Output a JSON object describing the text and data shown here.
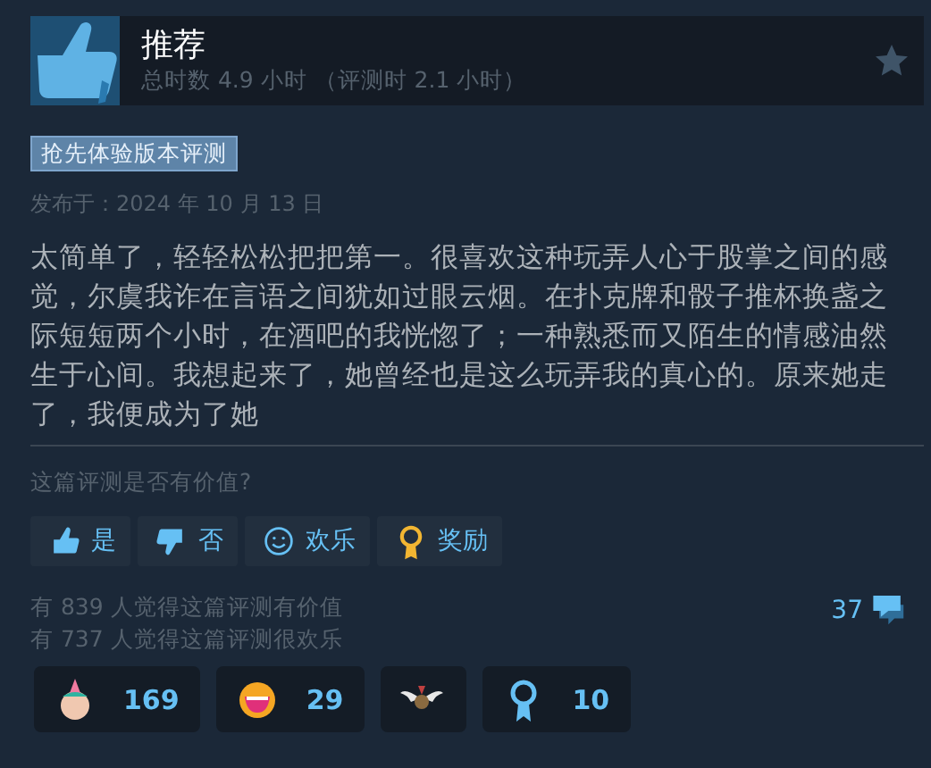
{
  "header": {
    "verdict": "推荐",
    "hours": "总时数 4.9 小时 （评测时 2.1 小时）",
    "recommended": true
  },
  "tag": "抢先体验版本评测",
  "posted": "发布于：2024 年 10 月 13 日",
  "body": "太简单了，轻轻松松把把第一。很喜欢这种玩弄人心于股掌之间的感觉，尔虞我诈在言语之间犹如过眼云烟。在扑克牌和骰子推杯换盏之际短短两个小时，在酒吧的我恍惚了；一种熟悉而又陌生的情感油然生于心间。我想起来了，她曾经也是这么玩弄我的真心的。原来她走了，我便成为了她",
  "question": "这篇评测是否有价值?",
  "vote_buttons": [
    {
      "kind": "yes",
      "label": "是"
    },
    {
      "kind": "no",
      "label": "否"
    },
    {
      "kind": "funny",
      "label": "欢乐"
    },
    {
      "kind": "award",
      "label": "奖励"
    }
  ],
  "stats": [
    "有 839 人觉得这篇评测有价值",
    "有 737 人觉得这篇评测很欢乐"
  ],
  "comments": "37",
  "awards": [
    {
      "kind": "badge",
      "count": "169"
    },
    {
      "kind": "laugh",
      "count": "29"
    },
    {
      "kind": "wings"
    },
    {
      "kind": "ribbon",
      "count": "10"
    }
  ]
}
